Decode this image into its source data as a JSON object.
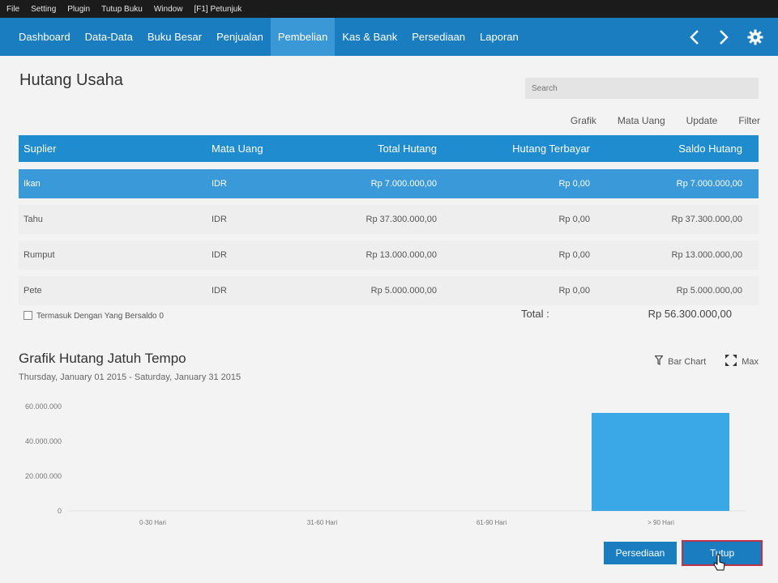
{
  "menubar": {
    "items": [
      "File",
      "Setting",
      "Plugin",
      "Tutup Buku",
      "Window",
      "[F1] Petunjuk"
    ]
  },
  "nav": {
    "items": [
      "Dashboard",
      "Data-Data",
      "Buku Besar",
      "Penjualan",
      "Pembelian",
      "Kas & Bank",
      "Persediaan",
      "Laporan"
    ],
    "active": "Pembelian",
    "icons": [
      "chevron-left-icon",
      "chevron-right-icon",
      "gear-icon"
    ]
  },
  "page": {
    "title": "Hutang Usaha"
  },
  "search": {
    "placeholder": "Search"
  },
  "actions": [
    "Grafik",
    "Mata Uang",
    "Update",
    "Filter"
  ],
  "table": {
    "headers": [
      "Suplier",
      "Mata Uang",
      "Total Hutang",
      "Hutang Terbayar",
      "Saldo Hutang"
    ],
    "rows": [
      [
        "Ikan",
        "IDR",
        "Rp 7.000.000,00",
        "Rp 0,00",
        "Rp 7.000.000,00"
      ],
      [
        "Tahu",
        "IDR",
        "Rp 37.300.000,00",
        "Rp 0,00",
        "Rp 37.300.000,00"
      ],
      [
        "Rumput",
        "IDR",
        "Rp 13.000.000,00",
        "Rp 0,00",
        "Rp 13.000.000,00"
      ],
      [
        "Pete",
        "IDR",
        "Rp 5.000.000,00",
        "Rp 0,00",
        "Rp 5.000.000,00"
      ]
    ]
  },
  "footer": {
    "checkbox_label": "Termasuk Dengan Yang Bersaldo 0",
    "total_label": "Total :",
    "total_value": "Rp 56.300.000,00"
  },
  "chart_section": {
    "title": "Grafik Hutang Jatuh Tempo",
    "subtitle": "Thursday, January 01 2015 - Saturday, January 31 2015",
    "tools": [
      {
        "label": "Bar Chart",
        "icon": "filter-icon"
      },
      {
        "label": "Max",
        "icon": "expand-icon"
      }
    ]
  },
  "chart_data": {
    "type": "bar",
    "categories": [
      "0-30 Hari",
      "31-60 Hari",
      "61-90 Hari",
      "> 90 Hari"
    ],
    "values": [
      0,
      0,
      0,
      56300000
    ],
    "ytick_labels": [
      "0",
      "20.000.000",
      "40.000.000",
      "60.000.000"
    ],
    "ylim": [
      0,
      60000000
    ],
    "bar_color": "#3aa7e6",
    "grid": false
  },
  "buttons": {
    "print": "Persediaan",
    "close": "Tutup"
  },
  "colors": {
    "nav": "#1a7dc0",
    "header": "#1f8ccf",
    "selected_row": "#3a9ad9"
  }
}
